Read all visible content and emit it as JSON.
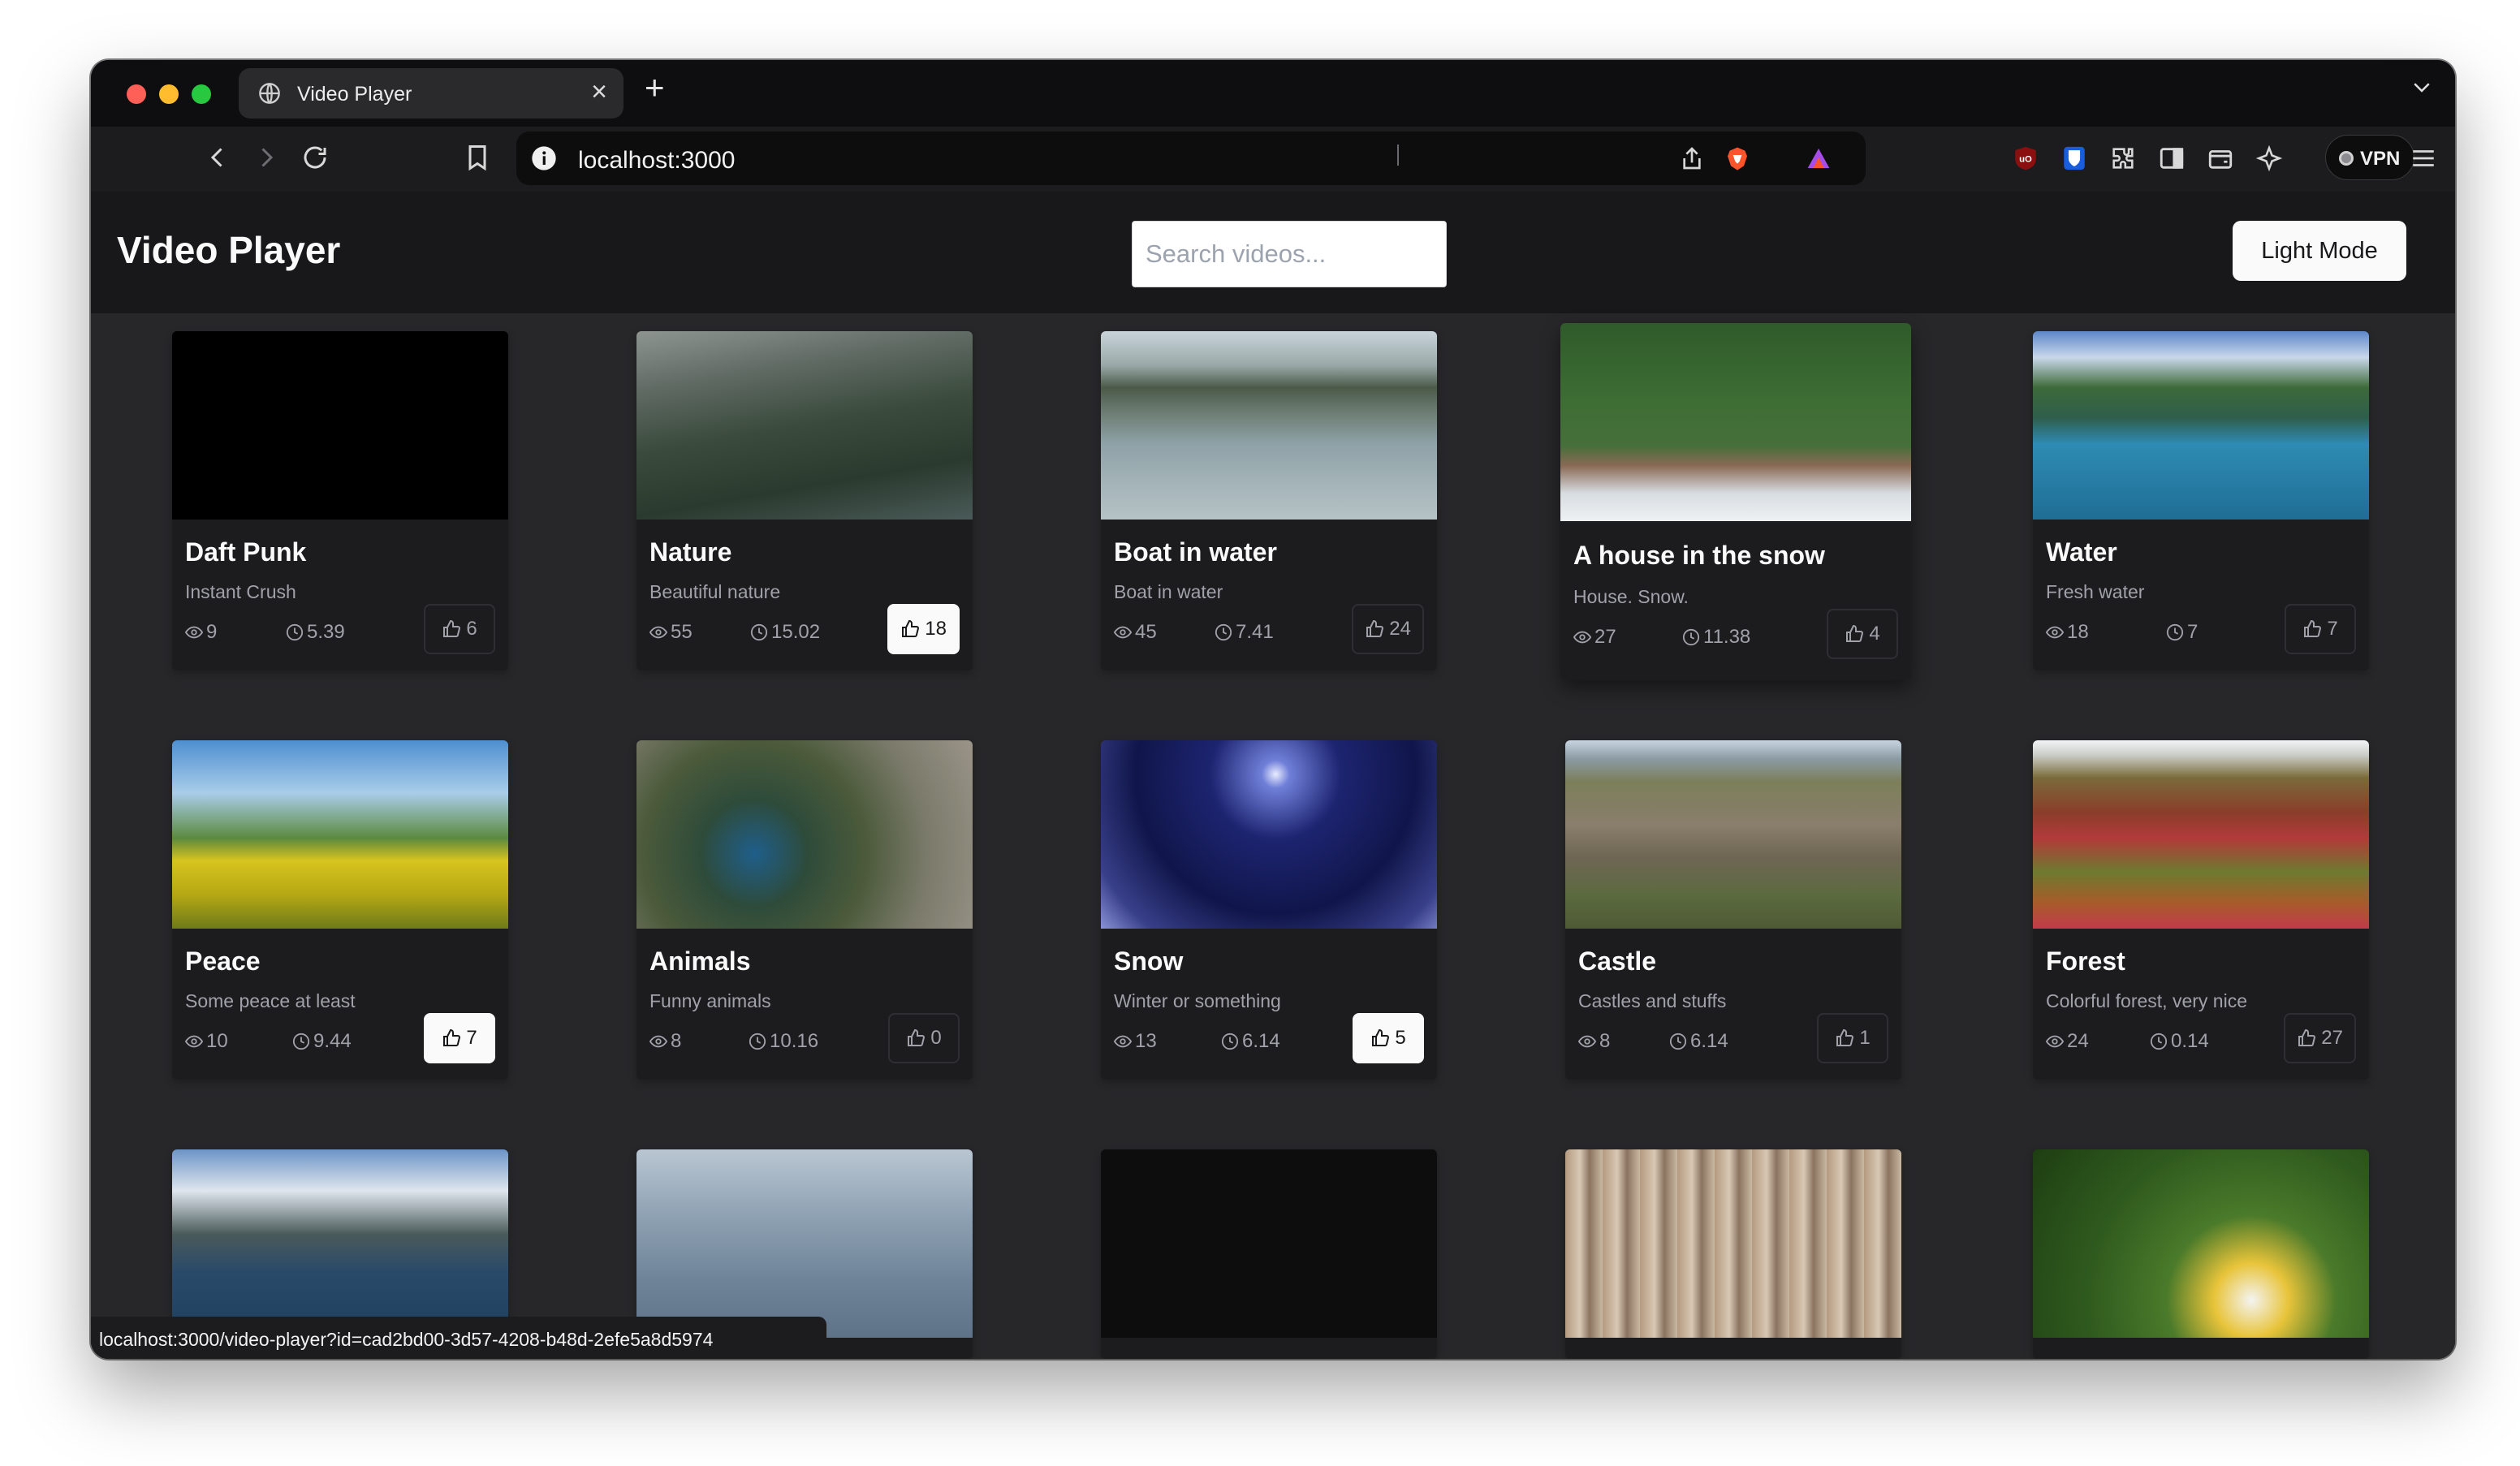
{
  "browser": {
    "tab_title": "Video Player",
    "tab_close": "×",
    "new_tab": "+",
    "url": "localhost:3000",
    "vpn_label": "VPN",
    "status_url": "localhost:3000/video-player?id=cad2bd00-3d57-4208-b48d-2efe5a8d5974"
  },
  "app": {
    "title": "Video Player",
    "search_placeholder": "Search videos...",
    "mode_button": "Light Mode"
  },
  "colors": {
    "accent": "#fafafa",
    "page_bg": "#18181b",
    "grid_bg": "#27272a",
    "card_bg": "#1c1c1f",
    "brave_orange": "#fb542b",
    "bitwarden_blue": "#175ddc"
  },
  "videos": [
    {
      "title": "Daft Punk",
      "description": "Instant Crush",
      "views": "9",
      "duration": "5.39",
      "likes": "6",
      "liked": false
    },
    {
      "title": "Nature",
      "description": "Beautiful nature",
      "views": "55",
      "duration": "15.02",
      "likes": "18",
      "liked": true
    },
    {
      "title": "Boat in water",
      "description": "Boat in water",
      "views": "45",
      "duration": "7.41",
      "likes": "24",
      "liked": false
    },
    {
      "title": "A house in the snow",
      "description": "House. Snow.",
      "views": "27",
      "duration": "11.38",
      "likes": "4",
      "liked": false,
      "hovered": true
    },
    {
      "title": "Water",
      "description": "Fresh water",
      "views": "18",
      "duration": "7",
      "likes": "7",
      "liked": false
    },
    {
      "title": "Peace",
      "description": "Some peace at least",
      "views": "10",
      "duration": "9.44",
      "likes": "7",
      "liked": true
    },
    {
      "title": "Animals",
      "description": "Funny animals",
      "views": "8",
      "duration": "10.16",
      "likes": "0",
      "liked": false
    },
    {
      "title": "Snow",
      "description": "Winter or something",
      "views": "13",
      "duration": "6.14",
      "likes": "5",
      "liked": true
    },
    {
      "title": "Castle",
      "description": "Castles and stuffs",
      "views": "8",
      "duration": "6.14",
      "likes": "1",
      "liked": false
    },
    {
      "title": "Forest",
      "description": "Colorful forest, very nice",
      "views": "24",
      "duration": "0.14",
      "likes": "27",
      "liked": false
    }
  ],
  "thumbnails": [
    "black",
    "mountain-valley",
    "lake-town",
    "snow-cabin",
    "river",
    "meadow",
    "peacock",
    "night-snow",
    "castle",
    "autumn-forest",
    "fjord",
    "cruise-ship",
    "black",
    "birch-forest",
    "flower-bee"
  ]
}
